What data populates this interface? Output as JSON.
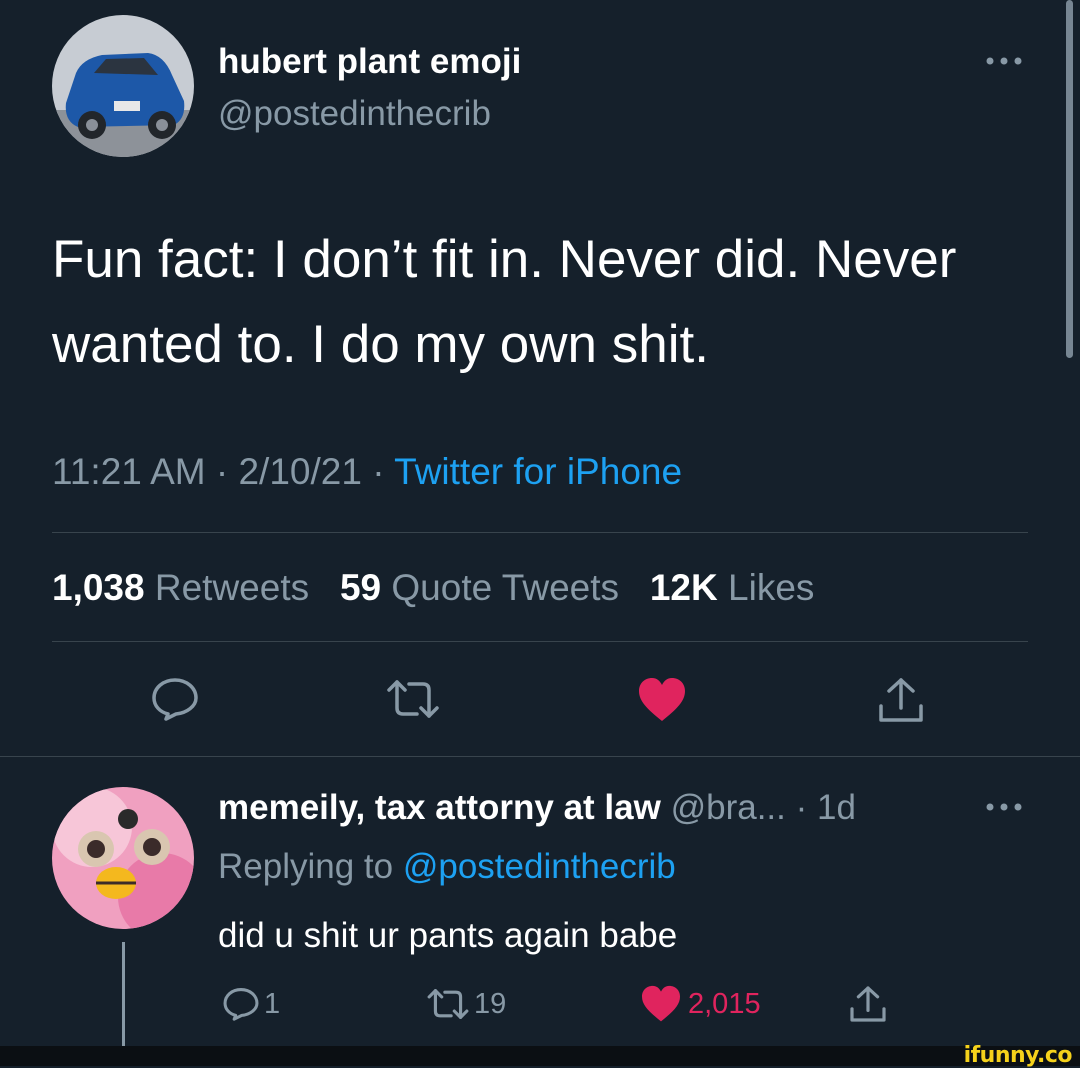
{
  "tweet": {
    "display_name": "hubert plant emoji",
    "handle": "@postedinthecrib",
    "text_line1": "Fun fact: I don’t fit in. Never did. Never",
    "text_line2": "wanted to. I do my own shit.",
    "time": "11:21 AM · 2/10/21 ·",
    "source": "Twitter for iPhone",
    "stats": {
      "retweets_count": "1,038",
      "retweets_label": "Retweets",
      "quotes_count": "59",
      "quotes_label": "Quote Tweets",
      "likes_count": "12K",
      "likes_label": "Likes"
    }
  },
  "reply": {
    "display_name": "memeily, tax attorny at law",
    "handle_time": "@bra... · 1d",
    "replying_prefix": "Replying to",
    "replying_handle": "@postedinthecrib",
    "text": "did u shit ur pants again babe",
    "reply_count": "1",
    "retweet_count": "19",
    "like_count": "2,015"
  },
  "watermark": "ifunny.co",
  "icons": [
    "more-icon",
    "reply-icon",
    "retweet-icon",
    "heart-icon",
    "share-icon"
  ],
  "colors": {
    "background": "#15202b",
    "accent": "#1da1f2",
    "like": "#e0245e",
    "muted": "#8899a6"
  }
}
